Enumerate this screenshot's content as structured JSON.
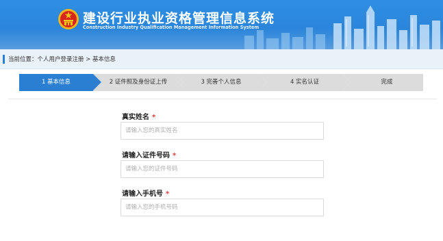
{
  "header": {
    "title_cn": "建设行业执业资格管理信息系统",
    "title_en": "Construction Industry Qualification Management Information System",
    "bg_color": "#2b86db",
    "emblem_icon": "national-emblem-icon"
  },
  "breadcrumb": {
    "text": "当前位置：个人用户登录注册 > 基本信息"
  },
  "steps": [
    {
      "label": "1 基本信息",
      "active": true
    },
    {
      "label": "2 证件照及身份证上传",
      "active": false
    },
    {
      "label": "3 完善个人信息",
      "active": false
    },
    {
      "label": "4 实名认证",
      "active": false
    },
    {
      "label": "完成",
      "active": false
    }
  ],
  "form": {
    "required_mark": "*",
    "fields": [
      {
        "label": "真实姓名",
        "placeholder": "请输入您的真实姓名",
        "value": ""
      },
      {
        "label": "请输入证件号码",
        "placeholder": "请输入您的证件号码",
        "value": ""
      },
      {
        "label": "请输入手机号",
        "placeholder": "请输入您的手机号码",
        "value": ""
      }
    ]
  },
  "colors": {
    "accent": "#2a7fd3",
    "step_inactive": "#dcdcdc",
    "required": "#e03a3a"
  }
}
